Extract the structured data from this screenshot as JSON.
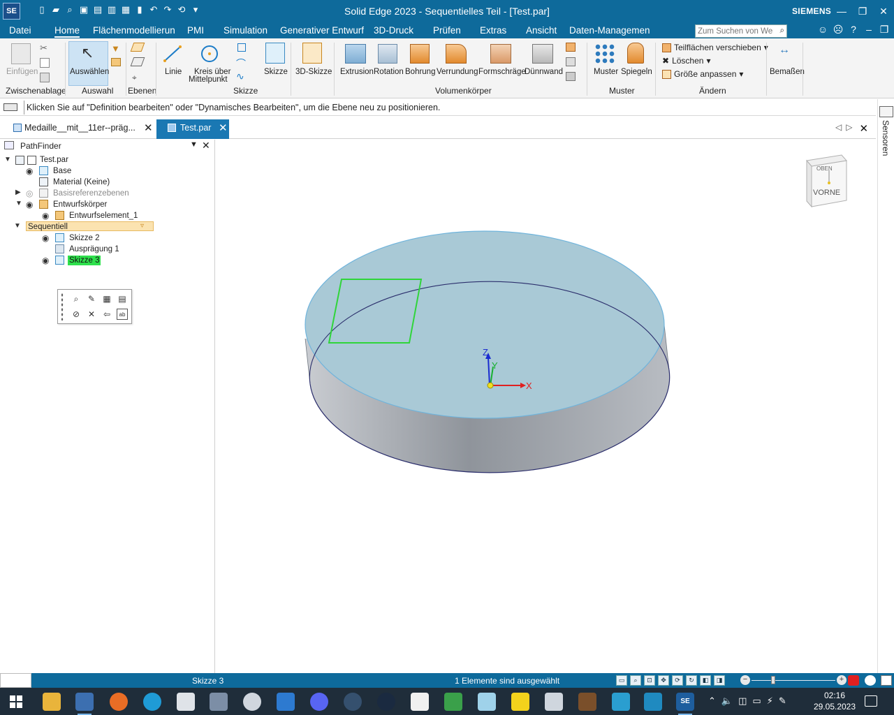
{
  "window": {
    "title": "Solid Edge 2023 - Sequentielles Teil - [Test.par]",
    "brand": "SIEMENS",
    "logo": "SE"
  },
  "menu": {
    "tabs": [
      "Datei",
      "Home",
      "Flächenmodellierun",
      "PMI",
      "Simulation",
      "Generativer Entwurf",
      "3D-Druck",
      "Prüfen",
      "Extras",
      "Ansicht",
      "Daten-Managemen"
    ],
    "active_tab": "Home",
    "search_placeholder": "Zum Suchen von Wer"
  },
  "ribbon": {
    "clipboard": {
      "paste": "Einfügen",
      "group": "Zwischenablage"
    },
    "select": {
      "label": "Auswählen",
      "group": "Auswahl"
    },
    "planes": {
      "group": "Ebenen"
    },
    "sketch": {
      "line": "Linie",
      "circle_1": "Kreis über",
      "circle_2": "Mittelpunkt",
      "sketch": "Skizze",
      "group": "Skizze"
    },
    "sketch3d": "3D-Skizze",
    "solids": {
      "extrusion": "Extrusion",
      "rotation": "Rotation",
      "hole": "Bohrung",
      "round": "Verrundung",
      "draft": "Formschräge",
      "thinwall": "Dünnwand",
      "group": "Volumenkörper"
    },
    "pattern": {
      "pattern": "Muster",
      "mirror": "Spiegeln",
      "group": "Muster"
    },
    "modify": {
      "move_faces": "Teilflächen verschieben",
      "delete": "Löschen",
      "resize": "Größe anpassen",
      "group": "Ändern"
    },
    "dimension": "Bemaßen"
  },
  "prompt": "Klicken Sie auf \"Definition bearbeiten\" oder \"Dynamisches Bearbeiten\", um die Ebene neu zu positionieren.",
  "sensor_label": "Sensoren",
  "doc_tabs": [
    {
      "label": "Medaille__mit__11er--präg..."
    },
    {
      "label": "Test.par"
    }
  ],
  "pathfinder": {
    "title": "PathFinder",
    "nodes": {
      "root": "Test.par",
      "base": "Base",
      "material": "Material (Keine)",
      "ref_planes": "Basisreferenzebenen",
      "design_body": "Entwurfskörper",
      "design_element": "Entwurfselement_1",
      "sequential": "Sequentiell",
      "sketch2": "Skizze 2",
      "protrusion": "Ausprägung 1",
      "sketch3": "Skizze 3"
    }
  },
  "viewcube": {
    "top": "OBEN",
    "front": "VORNE"
  },
  "axes": {
    "x": "X",
    "y": "Y",
    "z": "Z"
  },
  "status": {
    "selected_name": "Skizze 3",
    "selection_count": "1 Elemente sind ausgewählt"
  },
  "taskbar": {
    "time": "02:16",
    "date": "29.05.2023"
  }
}
